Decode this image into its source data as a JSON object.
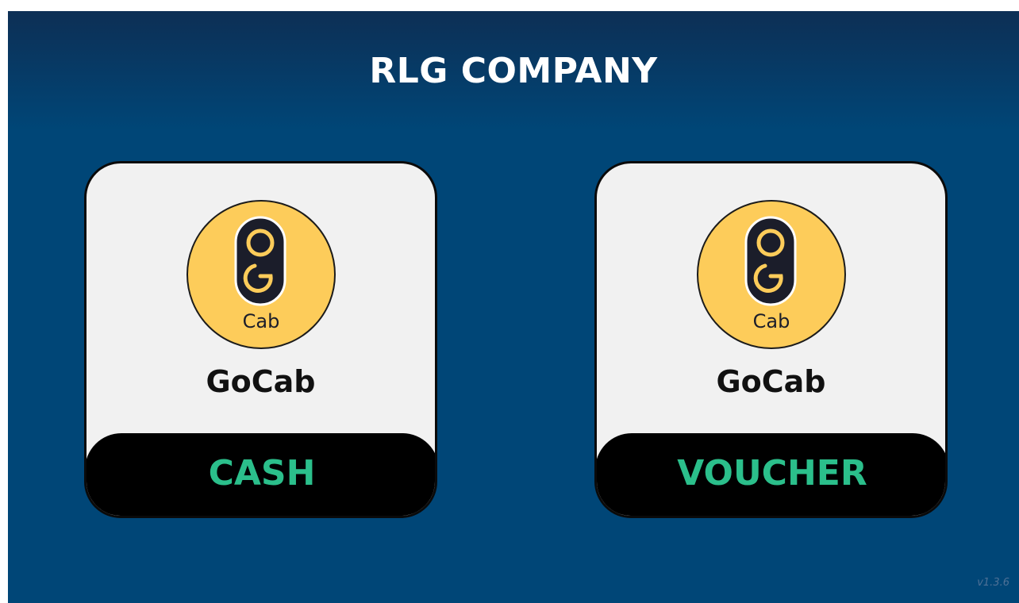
{
  "header": {
    "title": "RLG COMPANY"
  },
  "cards": [
    {
      "logo_icon": "gocab-logo-icon",
      "logo_text": "Cab",
      "brand": "GoCab",
      "payment_label": "CASH"
    },
    {
      "logo_icon": "gocab-logo-icon",
      "logo_text": "Cab",
      "brand": "GoCab",
      "payment_label": "VOUCHER"
    }
  ],
  "footer": {
    "version": "v1.3.6"
  },
  "colors": {
    "background": "#004677",
    "card": "#f1f1f1",
    "logo": "#fdcc5a",
    "label": "#2bbf8b"
  }
}
